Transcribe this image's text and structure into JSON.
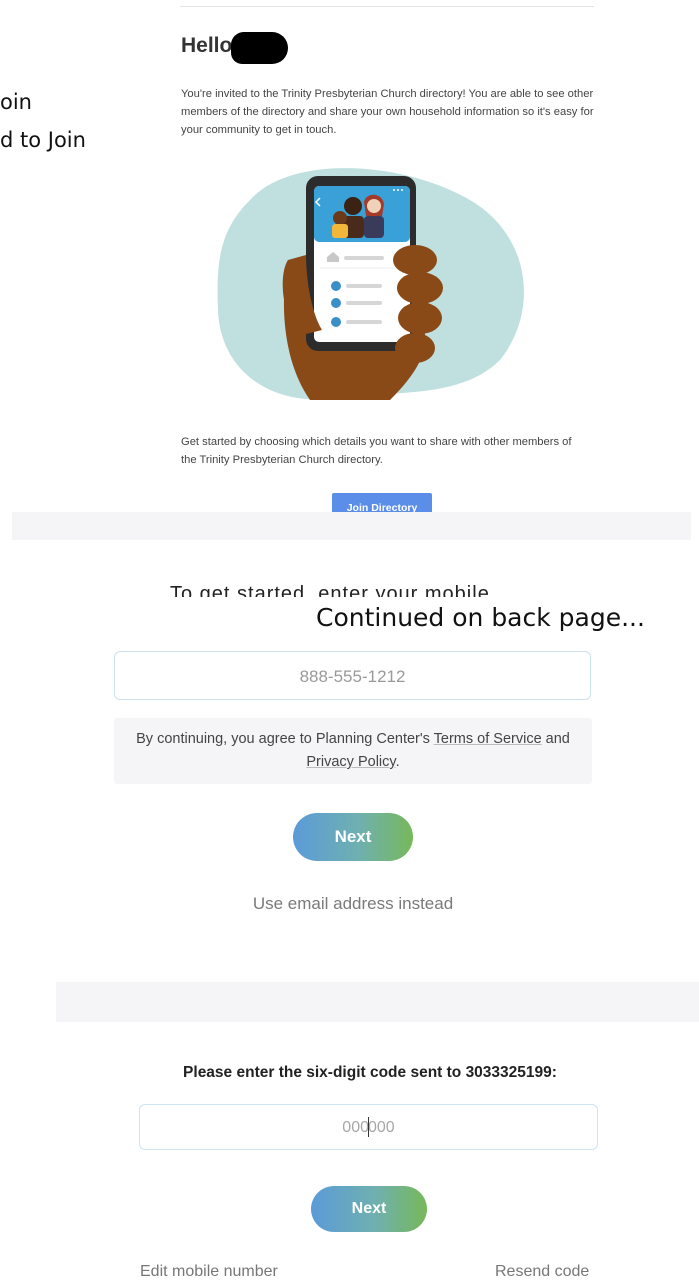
{
  "left_fragments": [
    "oin",
    "d to Join"
  ],
  "email": {
    "greeting": "Hello",
    "intro": "You're invited to the Trinity Presbyterian Church directory! You are able to see other members of the directory and share your own household information so it's easy for your community to get in touch.",
    "get_started": "Get started by choosing which details you want to share with other members of the Trinity Presbyterian Church directory.",
    "join_button": "Join Directory"
  },
  "cutoff_text": "To get started, enter your mobile number",
  "continued_note": "Continued on back page...",
  "phone_step": {
    "phone_placeholder": "888-555-1212",
    "terms_prefix": "By continuing, you agree to Planning Center's ",
    "terms_link": "Terms of Service",
    "terms_and": " and ",
    "privacy_link": "Privacy Policy",
    "terms_suffix": ".",
    "next_label": "Next",
    "email_instead": "Use email address instead"
  },
  "code_step": {
    "prompt": "Please enter the six-digit code sent to 3033325199:",
    "code_typed": "000",
    "code_rest": "000",
    "next_label": "Next",
    "edit_mobile": "Edit mobile number",
    "resend": "Resend code"
  },
  "colors": {
    "blob": "#bfe0df",
    "hand": "#8a4a18",
    "phone_frame": "#2c2c2c",
    "phone_header": "#3aa0d8",
    "join_button": "#5a8ee9",
    "next_gradient_start": "#5b9bd8",
    "next_gradient_end": "#77b85a"
  },
  "icons": [
    "house-icon",
    "person-icon",
    "back-arrow-icon",
    "more-icon"
  ]
}
